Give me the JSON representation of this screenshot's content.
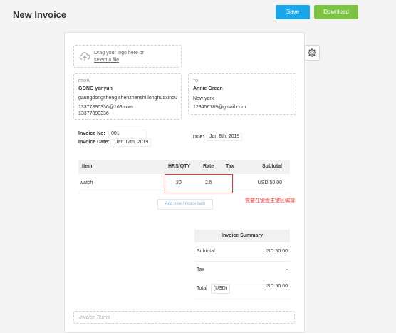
{
  "header": {
    "title": "New Invoice",
    "save_label": "Save",
    "download_label": "Download"
  },
  "logo": {
    "line1": "Drag your logo here or",
    "link": "select a file"
  },
  "from": {
    "label": "FROM",
    "name": "GONG yanyun",
    "address": "gaungdongsheng shenzhenshi longhuaxinqu",
    "email": "13377890336@163.com",
    "phone": "13377890336"
  },
  "to": {
    "label": "TO",
    "name": "Annie Green",
    "address": "New york",
    "email": "123456789@gmail.com"
  },
  "invoice": {
    "no_label": "Invoice No:",
    "no_value": "001",
    "date_label": "Invoice Date:",
    "date_value": "Jan 12th, 2019",
    "due_label": "Due:",
    "due_value": "Jan 8th, 2019"
  },
  "table": {
    "headers": {
      "item": "Item",
      "qty": "HRS/QTY",
      "rate": "Rate",
      "tax": "Tax",
      "subtotal": "Subtotal"
    },
    "rows": [
      {
        "item": "watch",
        "qty": "20",
        "rate": "2.5",
        "tax": "",
        "subtotal": "USD 50.00"
      }
    ],
    "add_label": "Add new invoice item"
  },
  "annotation": {
    "note": "需要在键盘主键区编辑",
    "color": "#e33333"
  },
  "summary": {
    "title": "Invoice Summary",
    "subtotal_label": "Subtotal",
    "subtotal_value": "USD 50.00",
    "tax_label": "Tax",
    "tax_value": "-",
    "total_label": "Total",
    "currency": "(USD)",
    "total_value": "USD 50.00"
  },
  "terms": {
    "placeholder": "Invoice Terms"
  },
  "colors": {
    "save": "#1aa6e8",
    "download": "#7cc243"
  }
}
